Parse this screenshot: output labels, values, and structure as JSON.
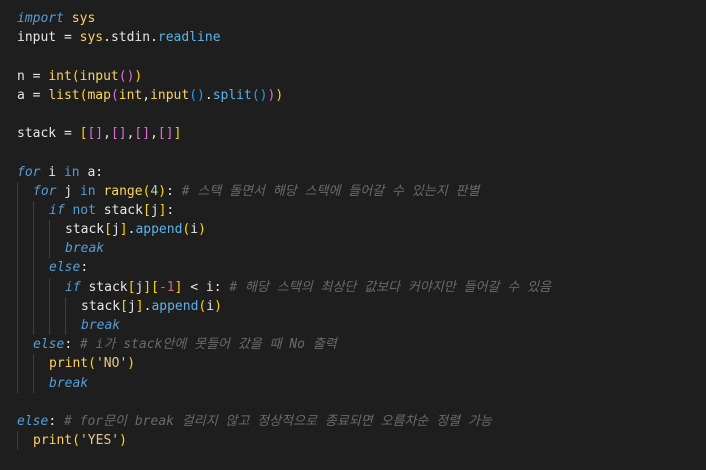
{
  "editor": {
    "theme": {
      "background": "#1e1e1e",
      "keyword": "#569cd6",
      "function": "#fcd45a",
      "comment": "#6a6a6a",
      "string": "#e8c88a"
    },
    "lines": [
      {
        "indent": 0,
        "tokens": [
          {
            "t": "import",
            "c": "kw-import"
          },
          {
            "t": " ",
            "c": "op"
          },
          {
            "t": "sys",
            "c": "mod"
          }
        ]
      },
      {
        "indent": 0,
        "tokens": [
          {
            "t": "input",
            "c": "ident"
          },
          {
            "t": " = ",
            "c": "op"
          },
          {
            "t": "sys",
            "c": "mod"
          },
          {
            "t": ".",
            "c": "op"
          },
          {
            "t": "stdin",
            "c": "ident"
          },
          {
            "t": ".",
            "c": "op"
          },
          {
            "t": "readline",
            "c": "attr"
          }
        ]
      },
      {
        "indent": 0,
        "tokens": []
      },
      {
        "indent": 0,
        "tokens": [
          {
            "t": "n",
            "c": "ident"
          },
          {
            "t": " = ",
            "c": "op"
          },
          {
            "t": "int",
            "c": "func"
          },
          {
            "t": "(",
            "c": "p1"
          },
          {
            "t": "input",
            "c": "func"
          },
          {
            "t": "()",
            "c": "p2"
          },
          {
            "t": ")",
            "c": "p1"
          }
        ]
      },
      {
        "indent": 0,
        "tokens": [
          {
            "t": "a",
            "c": "ident"
          },
          {
            "t": " = ",
            "c": "op"
          },
          {
            "t": "list",
            "c": "func"
          },
          {
            "t": "(",
            "c": "p1"
          },
          {
            "t": "map",
            "c": "func"
          },
          {
            "t": "(",
            "c": "p2"
          },
          {
            "t": "int",
            "c": "func"
          },
          {
            "t": ",",
            "c": "op"
          },
          {
            "t": "input",
            "c": "func"
          },
          {
            "t": "()",
            "c": "p3"
          },
          {
            "t": ".",
            "c": "op"
          },
          {
            "t": "split",
            "c": "attr"
          },
          {
            "t": "()",
            "c": "p3"
          },
          {
            "t": ")",
            "c": "p2"
          },
          {
            "t": ")",
            "c": "p1"
          }
        ]
      },
      {
        "indent": 0,
        "tokens": []
      },
      {
        "indent": 0,
        "tokens": [
          {
            "t": "stack",
            "c": "ident"
          },
          {
            "t": " = ",
            "c": "op"
          },
          {
            "t": "[",
            "c": "p1"
          },
          {
            "t": "[]",
            "c": "p2"
          },
          {
            "t": ",",
            "c": "op"
          },
          {
            "t": "[]",
            "c": "p2"
          },
          {
            "t": ",",
            "c": "op"
          },
          {
            "t": "[]",
            "c": "p2"
          },
          {
            "t": ",",
            "c": "op"
          },
          {
            "t": "[]",
            "c": "p2"
          },
          {
            "t": "]",
            "c": "p1"
          }
        ]
      },
      {
        "indent": 0,
        "tokens": []
      },
      {
        "indent": 0,
        "tokens": [
          {
            "t": "for",
            "c": "kw-ctrl"
          },
          {
            "t": " i ",
            "c": "ident"
          },
          {
            "t": "in",
            "c": "kw-not"
          },
          {
            "t": " a:",
            "c": "ident"
          }
        ]
      },
      {
        "indent": 1,
        "tokens": [
          {
            "t": "for",
            "c": "kw-ctrl"
          },
          {
            "t": " j ",
            "c": "ident"
          },
          {
            "t": "in",
            "c": "kw-not"
          },
          {
            "t": " ",
            "c": "op"
          },
          {
            "t": "range",
            "c": "func"
          },
          {
            "t": "(",
            "c": "p1"
          },
          {
            "t": "4",
            "c": "num"
          },
          {
            "t": ")",
            "c": "p1"
          },
          {
            "t": ": ",
            "c": "op"
          },
          {
            "t": "# 스택 돌면서 해당 스택에 들어갈 수 있는지 판별",
            "c": "cmt"
          }
        ]
      },
      {
        "indent": 2,
        "tokens": [
          {
            "t": "if",
            "c": "kw-ctrl"
          },
          {
            "t": " ",
            "c": "op"
          },
          {
            "t": "not",
            "c": "kw-not"
          },
          {
            "t": " stack",
            "c": "ident"
          },
          {
            "t": "[",
            "c": "p1"
          },
          {
            "t": "j",
            "c": "ident"
          },
          {
            "t": "]",
            "c": "p1"
          },
          {
            "t": ":",
            "c": "op"
          }
        ]
      },
      {
        "indent": 3,
        "tokens": [
          {
            "t": "stack",
            "c": "ident"
          },
          {
            "t": "[",
            "c": "p1"
          },
          {
            "t": "j",
            "c": "ident"
          },
          {
            "t": "]",
            "c": "p1"
          },
          {
            "t": ".",
            "c": "op"
          },
          {
            "t": "append",
            "c": "attr"
          },
          {
            "t": "(",
            "c": "p1"
          },
          {
            "t": "i",
            "c": "ident"
          },
          {
            "t": ")",
            "c": "p1"
          }
        ]
      },
      {
        "indent": 3,
        "tokens": [
          {
            "t": "break",
            "c": "kw-ctrl"
          }
        ]
      },
      {
        "indent": 2,
        "tokens": [
          {
            "t": "else",
            "c": "kw-ctrl"
          },
          {
            "t": ":",
            "c": "op"
          }
        ]
      },
      {
        "indent": 3,
        "tokens": [
          {
            "t": "if",
            "c": "kw-ctrl"
          },
          {
            "t": " stack",
            "c": "ident"
          },
          {
            "t": "[",
            "c": "p1"
          },
          {
            "t": "j",
            "c": "ident"
          },
          {
            "t": "]",
            "c": "p1"
          },
          {
            "t": "[",
            "c": "p1"
          },
          {
            "t": "-1",
            "c": "neg"
          },
          {
            "t": "]",
            "c": "p1"
          },
          {
            "t": " < i: ",
            "c": "op"
          },
          {
            "t": "# 해당 스택의 최상단 값보다 커야지만 들어갈 수 있음",
            "c": "cmt"
          }
        ]
      },
      {
        "indent": 4,
        "tokens": [
          {
            "t": "stack",
            "c": "ident"
          },
          {
            "t": "[",
            "c": "p1"
          },
          {
            "t": "j",
            "c": "ident"
          },
          {
            "t": "]",
            "c": "p1"
          },
          {
            "t": ".",
            "c": "op"
          },
          {
            "t": "append",
            "c": "attr"
          },
          {
            "t": "(",
            "c": "p1"
          },
          {
            "t": "i",
            "c": "ident"
          },
          {
            "t": ")",
            "c": "p1"
          }
        ]
      },
      {
        "indent": 4,
        "tokens": [
          {
            "t": "break",
            "c": "kw-ctrl"
          }
        ]
      },
      {
        "indent": 1,
        "tokens": [
          {
            "t": "else",
            "c": "kw-ctrl"
          },
          {
            "t": ": ",
            "c": "op"
          },
          {
            "t": "# i가 stack안에 못들어 갔을 때 No 출력",
            "c": "cmt"
          }
        ]
      },
      {
        "indent": 2,
        "tokens": [
          {
            "t": "print",
            "c": "func"
          },
          {
            "t": "(",
            "c": "p1"
          },
          {
            "t": "'NO'",
            "c": "str"
          },
          {
            "t": ")",
            "c": "p1"
          }
        ]
      },
      {
        "indent": 2,
        "tokens": [
          {
            "t": "break",
            "c": "kw-ctrl"
          }
        ]
      },
      {
        "indent": 0,
        "tokens": []
      },
      {
        "indent": 0,
        "tokens": [
          {
            "t": "else",
            "c": "kw-ctrl"
          },
          {
            "t": ": ",
            "c": "op"
          },
          {
            "t": "# for문이 break 걸리지 않고 정상적으로 종료되면 오름차순 정렬 가능",
            "c": "cmt"
          }
        ]
      },
      {
        "indent": 1,
        "tokens": [
          {
            "t": "print",
            "c": "func"
          },
          {
            "t": "(",
            "c": "p1"
          },
          {
            "t": "'YES'",
            "c": "str"
          },
          {
            "t": ")",
            "c": "p1"
          }
        ]
      }
    ]
  }
}
